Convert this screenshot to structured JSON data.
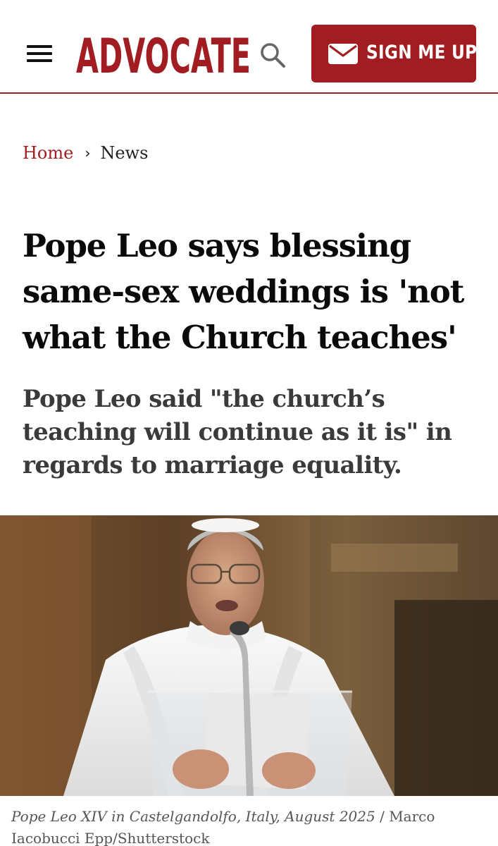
{
  "header": {
    "logo_text": "ADVOCATE",
    "signup_label": "SIGN ME UP",
    "brand_color": "#a11d22",
    "icons": [
      "menu-icon",
      "search-icon",
      "envelope-icon"
    ]
  },
  "breadcrumb": {
    "home": "Home",
    "separator": "›",
    "current": "News"
  },
  "article": {
    "headline": "Pope Leo says blessing same-sex weddings is 'not what the Church teaches'",
    "dek": "Pope Leo said \"the church’s teaching will continue as it is\" in regards to marriage equality.",
    "caption": {
      "description": "Pope Leo XIV in Castelgandolfo, Italy, August 2025",
      "separator": "/",
      "credit": "Marco Iacobucci Epp/Shutterstock"
    }
  }
}
